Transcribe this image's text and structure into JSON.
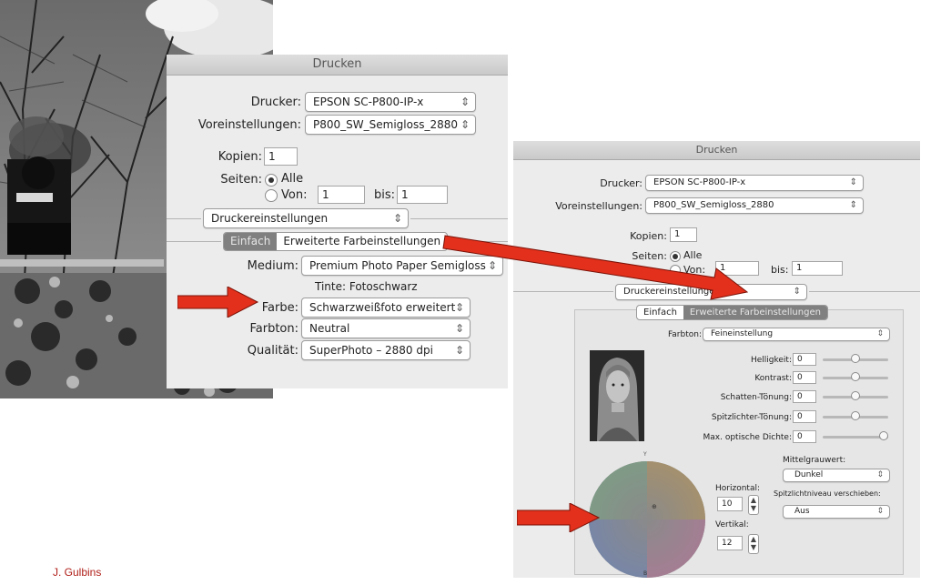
{
  "credit": "J. Gulbins",
  "dialog1": {
    "title": "Drucken",
    "drucker_label": "Drucker:",
    "drucker_value": "EPSON SC-P800-IP-x",
    "voreinstellungen_label": "Voreinstellungen:",
    "voreinstellungen_value": "P800_SW_Semigloss_2880",
    "kopien_label": "Kopien:",
    "kopien_value": "1",
    "seiten_label": "Seiten:",
    "alle_label": "Alle",
    "von_label": "Von:",
    "von_value": "1",
    "bis_label": "bis:",
    "bis_value": "1",
    "section_value": "Druckereinstellungen",
    "tab_einfach": "Einfach",
    "tab_erweitert": "Erweiterte Farbeinstellungen",
    "medium_label": "Medium:",
    "medium_value": "Premium Photo Paper Semigloss",
    "tinte_text": "Tinte: Fotoschwarz",
    "farbe_label": "Farbe:",
    "farbe_value": "Schwarzweißfoto erweitert",
    "farbton_label": "Farbton:",
    "farbton_value": "Neutral",
    "qualitaet_label": "Qualität:",
    "qualitaet_value": "SuperPhoto – 2880 dpi"
  },
  "dialog2": {
    "title": "Drucken",
    "drucker_label": "Drucker:",
    "drucker_value": "EPSON SC-P800-IP-x",
    "voreinstellungen_label": "Voreinstellungen:",
    "voreinstellungen_value": "P800_SW_Semigloss_2880",
    "kopien_label": "Kopien:",
    "kopien_value": "1",
    "seiten_label": "Seiten:",
    "alle_label": "Alle",
    "von_label": "Von:",
    "von_value": "1",
    "bis_label": "bis:",
    "bis_value": "1",
    "section_value": "Druckereinstellungen",
    "tab_einfach": "Einfach",
    "tab_erweitert": "Erweiterte Farbeinstellungen",
    "farbton_label": "Farbton:",
    "farbton_value": "Feineinstellung",
    "helligkeit_label": "Helligkeit:",
    "helligkeit_value": "0",
    "kontrast_label": "Kontrast:",
    "kontrast_value": "0",
    "schatten_label": "Schatten-Tönung:",
    "schatten_value": "0",
    "spitzlichter_label": "Spitzlichter-Tönung:",
    "spitzlichter_value": "0",
    "maxdichte_label": "Max. optische Dichte:",
    "maxdichte_value": "0",
    "mittelgrau_label": "Mittelgrauwert:",
    "mittelgrau_value": "Dunkel",
    "spitzlicht_label": "Spitzlichtniveau verschieben:",
    "spitzlicht_value": "Aus",
    "horizontal_label": "Horizontal:",
    "horizontal_value": "10",
    "vertikal_label": "Vertikal:",
    "vertikal_value": "12",
    "wheel_top": "Y",
    "wheel_bottom": "B",
    "wheel_center": "⊕"
  },
  "colors": {
    "arrow": "#e2301c",
    "credit": "#b0201a",
    "segment_selected": "#808080"
  }
}
